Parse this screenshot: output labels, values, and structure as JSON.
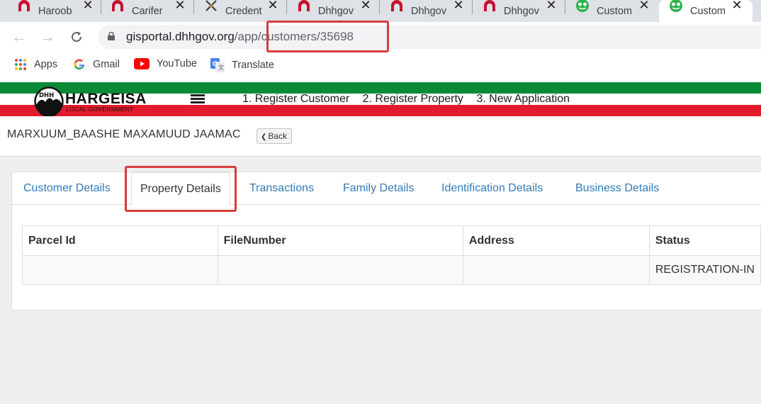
{
  "browser": {
    "tabs": [
      {
        "label": "Haroob",
        "icon": "arch-icon"
      },
      {
        "label": "Carifer",
        "icon": "arch-icon"
      },
      {
        "label": "Credent",
        "icon": "x-logo-icon"
      },
      {
        "label": "Dhhgov",
        "icon": "arch-icon"
      },
      {
        "label": "Dhhgov",
        "icon": "arch-icon"
      },
      {
        "label": "Dhhgov",
        "icon": "arch-icon"
      },
      {
        "label": "Custom",
        "icon": "frog-icon"
      },
      {
        "label": "Custom",
        "icon": "frog-icon"
      }
    ],
    "url_host": "gisportal.dhhgov.org",
    "url_path": "/app/customers/35698",
    "bookmarks": [
      {
        "label": "Apps",
        "icon": "apps-grid-icon"
      },
      {
        "label": "Gmail",
        "icon": "google-icon"
      },
      {
        "label": "YouTube",
        "icon": "youtube-icon"
      },
      {
        "label": "Translate",
        "icon": "translate-icon"
      }
    ]
  },
  "site": {
    "logo_title": "HARGEISA",
    "logo_subtitle": "LOCAL GOVERNMENT",
    "logo_badge": "DHH",
    "nav": [
      "1. Register Customer",
      "2. Register Property",
      "3. New Application"
    ],
    "colors": {
      "green": "#0a8a37",
      "red": "#e21b2c",
      "link": "#337ab7"
    }
  },
  "page": {
    "customer_name": "MARXUUM_BAASHE MAXAMUUD JAAMAC",
    "back_label": "Back",
    "tabs": [
      "Customer Details",
      "Property Details",
      "Transactions",
      "Family Details",
      "Identification Details",
      "Business Details"
    ],
    "active_tab": "Property Details",
    "table": {
      "columns": [
        "Parcel Id",
        "FileNumber",
        "Address",
        "Status"
      ],
      "rows": [
        [
          "",
          "",
          "",
          "REGISTRATION-IN"
        ]
      ]
    }
  }
}
